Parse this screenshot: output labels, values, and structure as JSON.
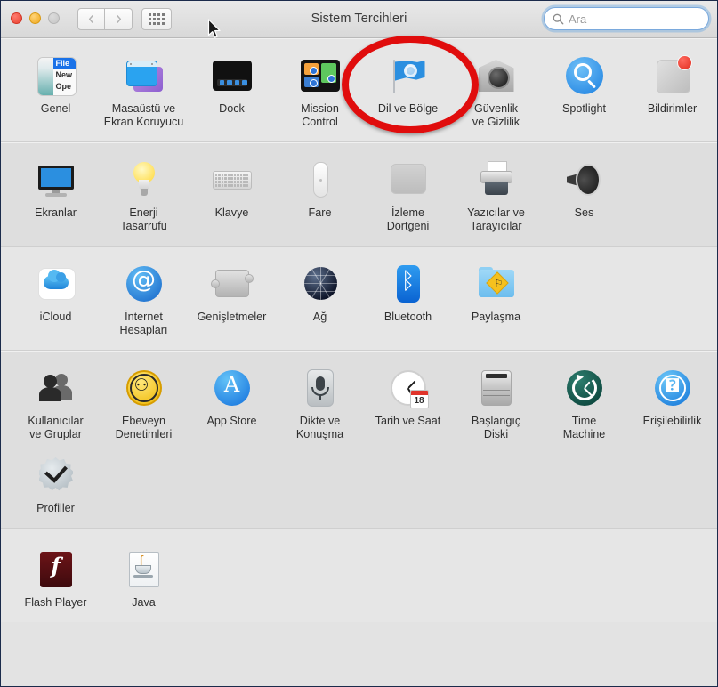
{
  "window": {
    "title": "Sistem Tercihleri",
    "traffic_lights": [
      "close",
      "minimize",
      "zoom"
    ]
  },
  "toolbar": {
    "back_label": "‹",
    "forward_label": "›",
    "grid_button_name": "show-all",
    "search": {
      "placeholder": "Ara",
      "value": "",
      "icon": "search-icon"
    }
  },
  "annotation": {
    "type": "ellipse",
    "color": "#e00d0d",
    "targets": "Dil ve Bölge"
  },
  "sections": [
    {
      "id": "personal",
      "items": [
        {
          "label": "Genel",
          "icon": "general-icon"
        },
        {
          "label": "Masaüstü ve\nEkran Koruyucu",
          "icon": "desktop-screensaver-icon"
        },
        {
          "label": "Dock",
          "icon": "dock-icon"
        },
        {
          "label": "Mission\nControl",
          "icon": "mission-control-icon"
        },
        {
          "label": "Dil ve Bölge",
          "icon": "language-region-icon"
        },
        {
          "label": "Güvenlik\nve Gizlilik",
          "icon": "security-privacy-icon"
        },
        {
          "label": "Spotlight",
          "icon": "spotlight-icon"
        },
        {
          "label": "Bildirimler",
          "icon": "notifications-icon",
          "badge": true
        }
      ]
    },
    {
      "id": "hardware",
      "items": [
        {
          "label": "Ekranlar",
          "icon": "displays-icon"
        },
        {
          "label": "Enerji\nTasarrufu",
          "icon": "energy-saver-icon"
        },
        {
          "label": "Klavye",
          "icon": "keyboard-icon"
        },
        {
          "label": "Fare",
          "icon": "mouse-icon"
        },
        {
          "label": "İzleme\nDörtgeni",
          "icon": "trackpad-icon"
        },
        {
          "label": "Yazıcılar ve\nTarayıcılar",
          "icon": "printers-scanners-icon"
        },
        {
          "label": "Ses",
          "icon": "sound-icon"
        }
      ]
    },
    {
      "id": "internet",
      "items": [
        {
          "label": "iCloud",
          "icon": "icloud-icon"
        },
        {
          "label": "İnternet\nHesapları",
          "icon": "internet-accounts-icon"
        },
        {
          "label": "Genişletmeler",
          "icon": "extensions-icon"
        },
        {
          "label": "Ağ",
          "icon": "network-icon"
        },
        {
          "label": "Bluetooth",
          "icon": "bluetooth-icon"
        },
        {
          "label": "Paylaşma",
          "icon": "sharing-icon"
        }
      ]
    },
    {
      "id": "system",
      "items": [
        {
          "label": "Kullanıcılar\nve Gruplar",
          "icon": "users-groups-icon"
        },
        {
          "label": "Ebeveyn\nDenetimleri",
          "icon": "parental-controls-icon"
        },
        {
          "label": "App Store",
          "icon": "app-store-icon"
        },
        {
          "label": "Dikte ve\nKonuşma",
          "icon": "dictation-speech-icon"
        },
        {
          "label": "Tarih ve Saat",
          "icon": "date-time-icon"
        },
        {
          "label": "Başlangıç\nDiski",
          "icon": "startup-disk-icon"
        },
        {
          "label": "Time\nMachine",
          "icon": "time-machine-icon"
        },
        {
          "label": "Erişilebilirlik",
          "icon": "accessibility-icon"
        },
        {
          "label": "Profiller",
          "icon": "profiles-icon"
        }
      ]
    },
    {
      "id": "other",
      "items": [
        {
          "label": "Flash Player",
          "icon": "flash-player-icon"
        },
        {
          "label": "Java",
          "icon": "java-icon"
        }
      ]
    }
  ]
}
